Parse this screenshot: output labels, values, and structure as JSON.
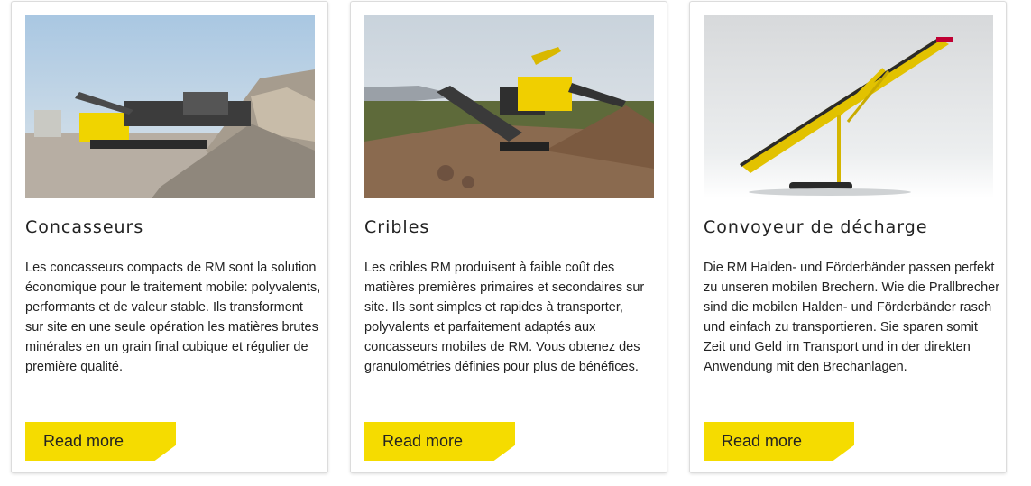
{
  "cards": [
    {
      "title": "Concasseurs",
      "text": "Les concasseurs compacts de RM sont la solution économique pour le traitement mobile: polyvalents, performants et de valeur stable. Ils transforment sur site en une seule opération les matières brutes minérales en un grain final cubique et régulier de première qualité.",
      "button": "Read more"
    },
    {
      "title": "Cribles",
      "text": "Les cribles RM produisent à faible coût des matières premières primaires et secondaires sur site. Ils sont simples et rapides à transporter, polyvalents et parfaitement adaptés aux concasseurs mobiles de RM. Vous obtenez des granulométries définies pour plus de bénéfices.",
      "button": "Read more"
    },
    {
      "title": "Convoyeur de décharge",
      "text": "Die RM Halden- und Förderbänder passen perfekt zu unseren mobilen Brechern. Wie die Prallbrecher sind die mobilen Halden- und Förderbänder rasch und einfach zu transportieren. Sie sparen somit Zeit und Geld im Transport und in der direkten Anwendung mit den Brechanlagen.",
      "button": "Read more"
    }
  ],
  "colors": {
    "accent": "#f5dc00",
    "text": "#222222"
  }
}
